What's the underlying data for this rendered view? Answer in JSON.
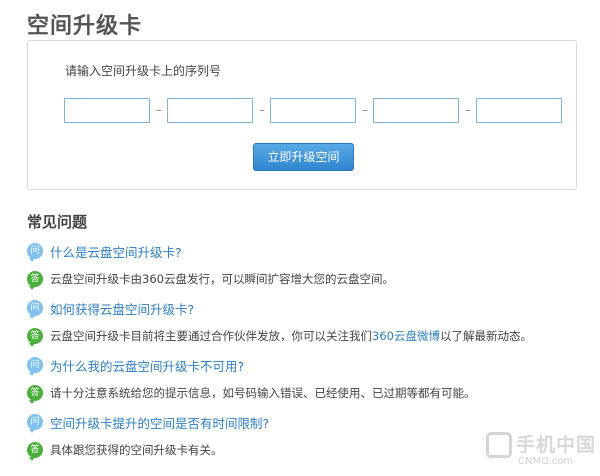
{
  "page": {
    "title": "空间升级卡"
  },
  "card": {
    "label": "请输入空间升级卡上的序列号",
    "inputs": [
      "",
      "",
      "",
      "",
      ""
    ],
    "dash": "–",
    "submit_label": "立即升级空间"
  },
  "faq": {
    "title": "常见问题",
    "q_badge": "问",
    "a_badge": "答",
    "items": [
      {
        "question": "什么是云盘空间升级卡?",
        "answer": "云盘空间升级卡由360云盘发行，可以瞬间扩容增大您的云盘空间。"
      },
      {
        "question": "如何获得云盘空间升级卡?",
        "answer_before": "云盘空间升级卡目前将主要通过合作伙伴发放，你可以关注我们",
        "answer_link": "360云盘微博",
        "answer_after": "以了解最新动态。"
      },
      {
        "question": "为什么我的云盘空间升级卡不可用?",
        "answer": "请十分注意系统给您的提示信息，如号码输入错误、已经使用、已过期等都有可能。"
      },
      {
        "question": "空间升级卡提升的空间是否有时间限制?",
        "answer": "具体跟您获得的空间升级卡有关。"
      }
    ]
  },
  "watermark": {
    "text": "手机中国",
    "sub": "CNMO.com"
  },
  "colors": {
    "question_blue": "#2f7fc3",
    "answer_green": "#4caf3c",
    "q_badge_blue": "#7ec0ee",
    "button_blue": "#3a8fd6"
  }
}
